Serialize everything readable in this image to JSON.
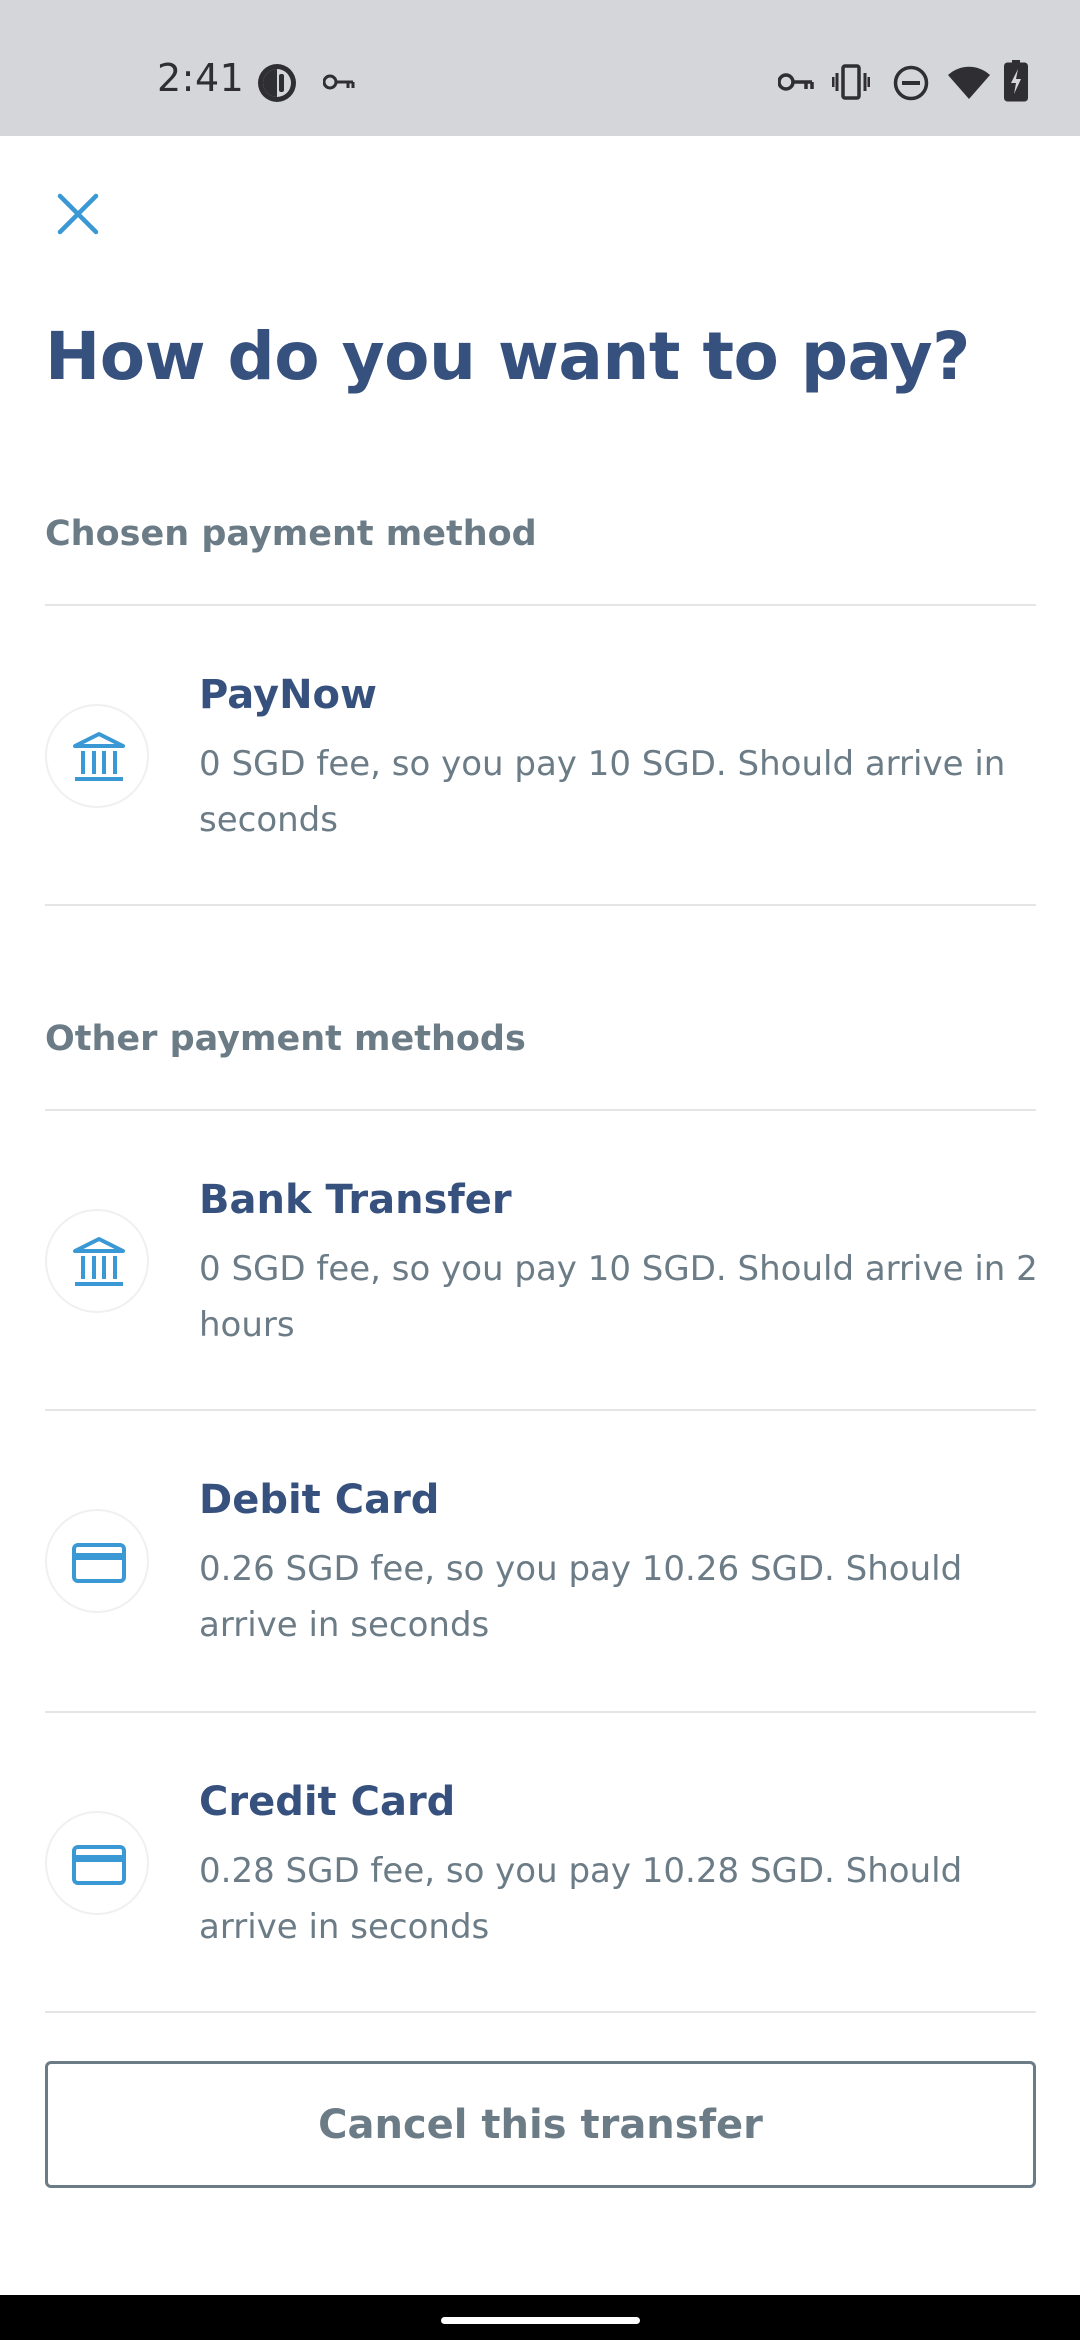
{
  "status_bar": {
    "time": "2:41",
    "icons": [
      "notification-app-icon",
      "vpn-key-icon",
      "vpn-key-icon",
      "vibrate-icon",
      "do-not-disturb-icon",
      "wifi-icon",
      "battery-charging-icon"
    ]
  },
  "header": {
    "close_icon": "close-icon",
    "title": "How do you want to pay?"
  },
  "chosen_section": {
    "label": "Chosen payment method",
    "method": {
      "icon": "bank-icon",
      "name": "PayNow",
      "description": "0 SGD fee, so you pay 10 SGD. Should arrive in seconds"
    }
  },
  "other_section": {
    "label": "Other payment methods",
    "methods": [
      {
        "icon": "bank-icon",
        "name": "Bank Transfer",
        "description": "0 SGD fee, so you pay 10 SGD. Should arrive in 2 hours"
      },
      {
        "icon": "card-icon",
        "name": "Debit Card",
        "description": "0.26 SGD fee, so you pay 10.26 SGD. Should arrive in seconds"
      },
      {
        "icon": "card-icon",
        "name": "Credit Card",
        "description": "0.28 SGD fee, so you pay 10.28 SGD. Should arrive in seconds"
      }
    ]
  },
  "footer": {
    "cancel_label": "Cancel this transfer"
  },
  "colors": {
    "heading": "#37517e",
    "secondary_text": "#6b7c87",
    "accent": "#3a99d4",
    "status_bar_bg": "#d5d6da"
  }
}
